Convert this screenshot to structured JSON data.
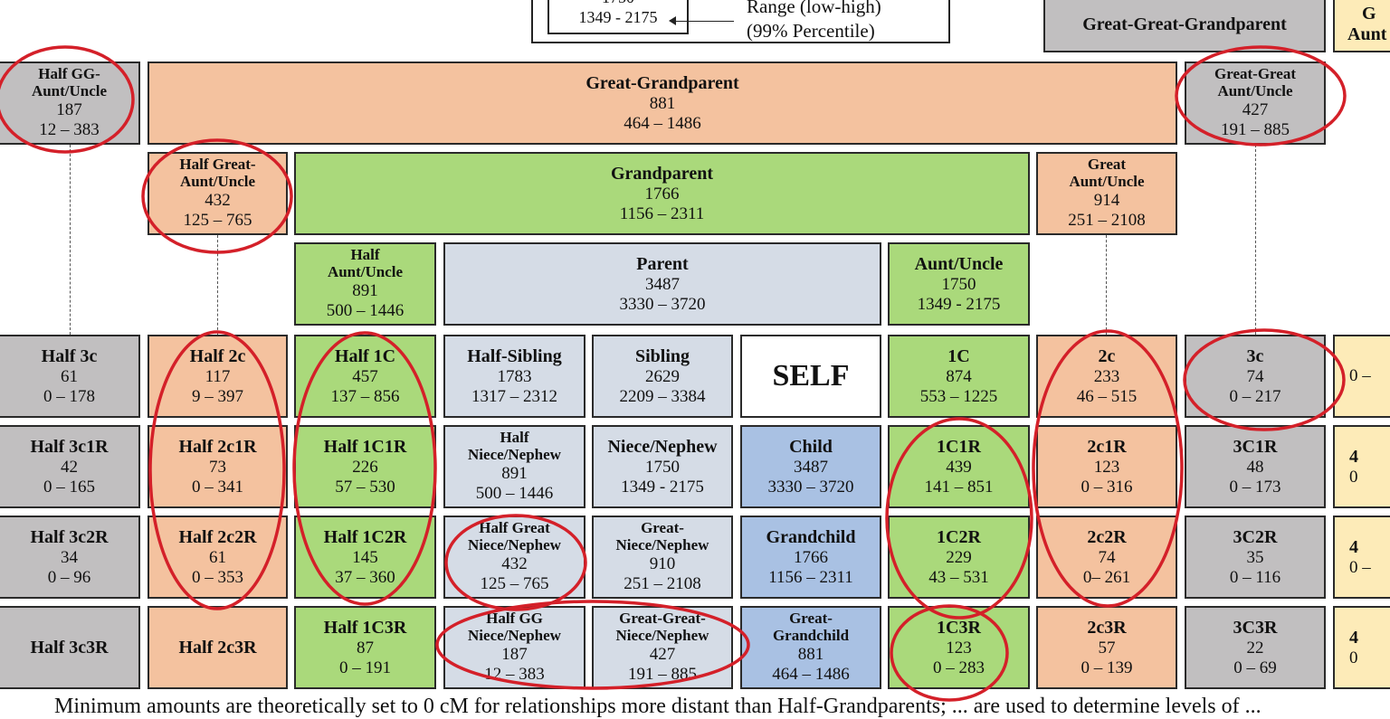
{
  "legend": {
    "avg_partial": "1750",
    "range_example": "1349 - 2175",
    "range_label": "Range (low-high)",
    "percentile_label": "(99% Percentile)"
  },
  "top": {
    "ggg_parent": {
      "title": "Great-Great-Grandparent",
      "color": "gray"
    },
    "ggg_aunt_partial": {
      "title_partial": "G",
      "line2_partial": "Aunt",
      "color": "yellow"
    },
    "half_gg_aunt": {
      "title": "Half GG-Aunt/Uncle",
      "avg": "187",
      "range": "12 – 383",
      "color": "gray"
    },
    "great_grandparent": {
      "title": "Great-Grandparent",
      "avg": "881",
      "range": "464 – 1486",
      "color": "salmon"
    },
    "gg_aunt": {
      "title": "Great-Great Aunt/Uncle",
      "avg": "427",
      "range": "191 – 885",
      "color": "gray"
    },
    "half_great_aunt": {
      "title": "Half Great-Aunt/Uncle",
      "avg": "432",
      "range": "125 – 765",
      "color": "salmon"
    },
    "grandparent": {
      "title": "Grandparent",
      "avg": "1766",
      "range": "1156 – 2311",
      "color": "green"
    },
    "great_aunt": {
      "title": "Great Aunt/Uncle",
      "avg": "914",
      "range": "251 – 2108",
      "color": "salmon"
    },
    "half_aunt": {
      "title": "Half Aunt/Uncle",
      "avg": "891",
      "range": "500 – 1446",
      "color": "green"
    },
    "parent": {
      "title": "Parent",
      "avg": "3487",
      "range": "3330 – 3720",
      "color": "lb"
    },
    "aunt": {
      "title": "Aunt/Uncle",
      "avg": "1750",
      "range": "1349 - 2175",
      "color": "green"
    }
  },
  "grid": [
    [
      {
        "title": "Half 3c",
        "avg": "61",
        "range": "0 – 178",
        "color": "gray"
      },
      {
        "title": "Half 2c",
        "avg": "117",
        "range": "9 – 397",
        "color": "salmon"
      },
      {
        "title": "Half 1C",
        "avg": "457",
        "range": "137 – 856",
        "color": "green"
      },
      {
        "title": "Half-Sibling",
        "avg": "1783",
        "range": "1317 – 2312",
        "color": "lb"
      },
      {
        "title": "Sibling",
        "avg": "2629",
        "range": "2209 – 3384",
        "color": "lb"
      },
      {
        "title": "SELF",
        "avg": "",
        "range": "",
        "color": "white"
      },
      {
        "title": "1C",
        "avg": "874",
        "range": "553 – 1225",
        "color": "green"
      },
      {
        "title": "2c",
        "avg": "233",
        "range": "46 – 515",
        "color": "salmon"
      },
      {
        "title": "3c",
        "avg": "74",
        "range": "0 – 217",
        "color": "gray"
      },
      {
        "title": "",
        "avg": "",
        "range": "0 –",
        "color": "yellow"
      }
    ],
    [
      {
        "title": "Half 3c1R",
        "avg": "42",
        "range": "0 – 165",
        "color": "gray"
      },
      {
        "title": "Half 2c1R",
        "avg": "73",
        "range": "0 – 341",
        "color": "salmon"
      },
      {
        "title": "Half 1C1R",
        "avg": "226",
        "range": "57 – 530",
        "color": "green"
      },
      {
        "title": "Half Niece/Nephew",
        "avg": "891",
        "range": "500 – 1446",
        "color": "lb"
      },
      {
        "title": "Niece/Nephew",
        "avg": "1750",
        "range": "1349 - 2175",
        "color": "lb"
      },
      {
        "title": "Child",
        "avg": "3487",
        "range": "3330 – 3720",
        "color": "blue"
      },
      {
        "title": "1C1R",
        "avg": "439",
        "range": "141 – 851",
        "color": "green"
      },
      {
        "title": "2c1R",
        "avg": "123",
        "range": "0 – 316",
        "color": "salmon"
      },
      {
        "title": "3C1R",
        "avg": "48",
        "range": "0 – 173",
        "color": "gray"
      },
      {
        "title": "4",
        "avg": "",
        "range": "0",
        "color": "yellow"
      }
    ],
    [
      {
        "title": "Half 3c2R",
        "avg": "34",
        "range": "0 – 96",
        "color": "gray"
      },
      {
        "title": "Half 2c2R",
        "avg": "61",
        "range": "0 – 353",
        "color": "salmon"
      },
      {
        "title": "Half 1C2R",
        "avg": "145",
        "range": "37 – 360",
        "color": "green"
      },
      {
        "title": "Half Great Niece/Nephew",
        "avg": "432",
        "range": "125 – 765",
        "color": "lb"
      },
      {
        "title": "Great-Niece/Nephew",
        "avg": "910",
        "range": "251 – 2108",
        "color": "lb"
      },
      {
        "title": "Grandchild",
        "avg": "1766",
        "range": "1156 – 2311",
        "color": "blue"
      },
      {
        "title": "1C2R",
        "avg": "229",
        "range": "43 – 531",
        "color": "green"
      },
      {
        "title": "2c2R",
        "avg": "74",
        "range": "0– 261",
        "color": "salmon"
      },
      {
        "title": "3C2R",
        "avg": "35",
        "range": "0 – 116",
        "color": "gray"
      },
      {
        "title": "4",
        "avg": "",
        "range": "0 –",
        "color": "yellow"
      }
    ],
    [
      {
        "title": "Half 3c3R",
        "avg": "",
        "range": "",
        "color": "gray"
      },
      {
        "title": "Half 2c3R",
        "avg": "",
        "range": "",
        "color": "salmon"
      },
      {
        "title": "Half 1C3R",
        "avg": "87",
        "range": "0 – 191",
        "color": "green"
      },
      {
        "title": "Half GG Niece/Nephew",
        "avg": "187",
        "range": "12 – 383",
        "color": "lb"
      },
      {
        "title": "Great-Great-Niece/Nephew",
        "avg": "427",
        "range": "191 – 885",
        "color": "lb"
      },
      {
        "title": "Great-Grandchild",
        "avg": "881",
        "range": "464 – 1486",
        "color": "blue"
      },
      {
        "title": "1C3R",
        "avg": "123",
        "range": "0 – 283",
        "color": "green"
      },
      {
        "title": "2c3R",
        "avg": "57",
        "range": "0 – 139",
        "color": "salmon"
      },
      {
        "title": "3C3R",
        "avg": "22",
        "range": "0 – 69",
        "color": "gray"
      },
      {
        "title": "4",
        "avg": "",
        "range": "0",
        "color": "yellow"
      }
    ]
  ],
  "annotation_color": "#d42029",
  "footnote": "Minimum amounts are theoretically set to 0 cM for relationships more distant than Half-Grandparents; ... are used to determine levels of ..."
}
